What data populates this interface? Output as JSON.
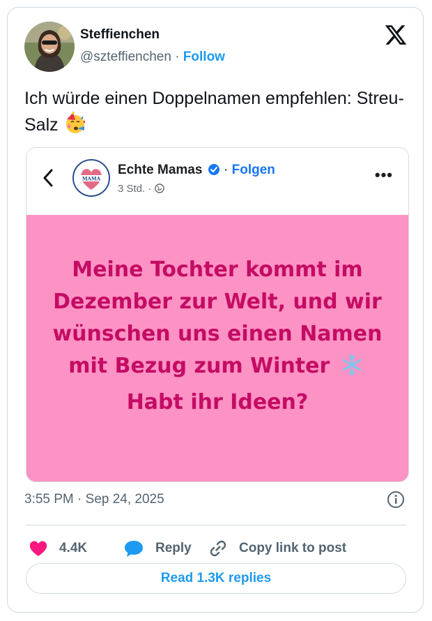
{
  "tweet": {
    "author_name": "Steffienchen",
    "handle": "@szteffienchen",
    "separator": "·",
    "follow_label": "Follow",
    "text": "Ich würde einen Doppelnamen empfehlen: Streu-Salz",
    "timestamp": "3:55 PM · Sep 24, 2025",
    "like_count": "4.4K",
    "reply_label": "Reply",
    "copy_link_label": "Copy link to post",
    "read_replies_label": "Read 1.3K replies"
  },
  "embed": {
    "page_name": "Echte Mamas",
    "separator": "·",
    "follow_label": "Folgen",
    "age": "3 Std.",
    "age_separator": "·",
    "logo_text": "MAMA",
    "post_text_before_emoji": "Meine Tochter kommt im Dezember zur Welt, und wir wünschen uns einen Namen mit Bezug zum Winter",
    "post_text_after_emoji": "Habt ihr Ideen?",
    "post_bg_color": "#fd92c4",
    "post_text_color": "#c40c64"
  },
  "icons": {
    "platform_logo": "x-logo-icon",
    "info": "info-icon",
    "like": "heart-icon",
    "reply": "speech-bubble-icon",
    "copy_link": "link-icon",
    "verified": "verified-badge-icon",
    "snowflake": "snowflake-icon",
    "party_emoji": "party-face-icon"
  }
}
